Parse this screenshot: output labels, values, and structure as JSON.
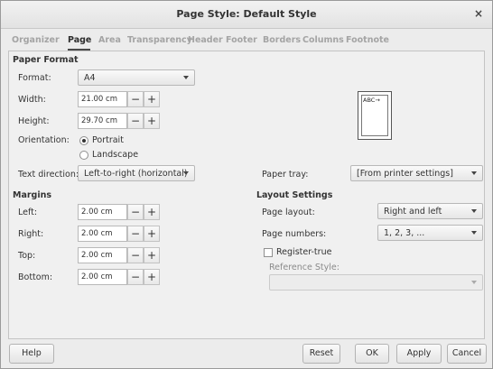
{
  "window": {
    "title": "Page Style: Default Style",
    "close_glyph": "×"
  },
  "tabs": [
    "Organizer",
    "Page",
    "Area",
    "Transparency",
    "Header",
    "Footer",
    "Borders",
    "Columns",
    "Footnote"
  ],
  "active_tab": "Page",
  "paper_format": {
    "heading": "Paper Format",
    "format_label": "Format:",
    "format_value": "A4",
    "width_label": "Width:",
    "width_value": "21.00 cm",
    "height_label": "Height:",
    "height_value": "29.70 cm",
    "orientation_label": "Orientation:",
    "portrait": "Portrait",
    "landscape": "Landscape",
    "orientation_selected": "Portrait",
    "text_direction_label": "Text direction:",
    "text_direction_value": "Left-to-right (horizontal)",
    "paper_tray_label": "Paper tray:",
    "paper_tray_value": "[From printer settings]"
  },
  "preview": {
    "text": "ABC→"
  },
  "margins": {
    "heading": "Margins",
    "left_label": "Left:",
    "left_value": "2.00 cm",
    "right_label": "Right:",
    "right_value": "2.00 cm",
    "top_label": "Top:",
    "top_value": "2.00 cm",
    "bottom_label": "Bottom:",
    "bottom_value": "2.00 cm"
  },
  "layout_settings": {
    "heading": "Layout Settings",
    "page_layout_label": "Page layout:",
    "page_layout_value": "Right and left",
    "page_numbers_label": "Page numbers:",
    "page_numbers_value": "1, 2, 3, ...",
    "register_true_label": "Register-true",
    "register_true_checked": false,
    "reference_style_label": "Reference Style:",
    "reference_style_value": ""
  },
  "spin": {
    "minus": "−",
    "plus": "+"
  },
  "buttons": {
    "help": "Help",
    "reset": "Reset",
    "ok": "OK",
    "apply": "Apply",
    "cancel": "Cancel"
  }
}
